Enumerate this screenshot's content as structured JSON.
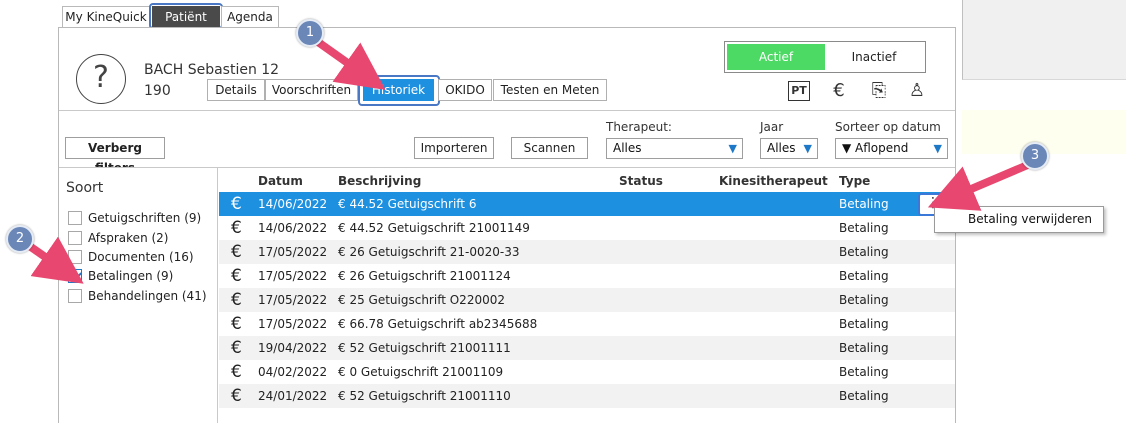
{
  "top_tabs": [
    "My KineQuick",
    "Patiënt",
    "Agenda"
  ],
  "patient": {
    "name": "BACH Sebastien 12",
    "number": "190",
    "avatar_glyph": "?"
  },
  "sub_tabs": [
    "Details",
    "Voorschriften",
    "Historiek",
    "OKIDO",
    "Testen en Meten"
  ],
  "status_toggle": {
    "active": "Actief",
    "inactive": "Inactief"
  },
  "header_icons": {
    "pt": "PT",
    "euro": "€",
    "doc_glyph": "⎘",
    "person_glyph": "♙"
  },
  "toolbar": {
    "hide_filters": "Verberg filters",
    "import": "Importeren",
    "scan": "Scannen",
    "therapist_label": "Therapeut:",
    "therapist_value": "Alles",
    "year_label": "Jaar",
    "year_value": "Alles",
    "sort_label": "Sorteer op datum",
    "sort_value": "▼ Aflopend",
    "dropdown_arrow": "▼"
  },
  "filters": {
    "title": "Soort",
    "items": [
      {
        "label": "Getuigschriften (9)",
        "checked": false
      },
      {
        "label": "Afspraken (2)",
        "checked": false
      },
      {
        "label": "Documenten (16)",
        "checked": false
      },
      {
        "label": "Betalingen (9)",
        "checked": true
      },
      {
        "label": "Behandelingen (41)",
        "checked": false
      }
    ]
  },
  "table": {
    "columns": [
      "Datum",
      "Beschrijving",
      "Status",
      "Kinesitherapeut",
      "Type"
    ],
    "row_icon": "€",
    "rows": [
      {
        "date": "14/06/2022",
        "desc": "€ 44.52 Getuigschrift 6",
        "type": "Betaling",
        "selected": true
      },
      {
        "date": "14/06/2022",
        "desc": "€ 44.52 Getuigschrift 21001149",
        "type": "Betaling"
      },
      {
        "date": "17/05/2022",
        "desc": "€ 26 Getuigschrift 21-0020-33",
        "type": "Betaling"
      },
      {
        "date": "17/05/2022",
        "desc": "€ 26 Getuigschrift 21001124",
        "type": "Betaling"
      },
      {
        "date": "17/05/2022",
        "desc": "€ 25 Getuigschrift O220002",
        "type": "Betaling"
      },
      {
        "date": "17/05/2022",
        "desc": "€ 66.78 Getuigschrift ab2345688",
        "type": "Betaling"
      },
      {
        "date": "19/04/2022",
        "desc": "€ 52 Getuigschrift 21001111",
        "type": "Betaling"
      },
      {
        "date": "04/02/2022",
        "desc": "€ 0 Getuigschrift 21001109",
        "type": "Betaling"
      },
      {
        "date": "24/01/2022",
        "desc": "€ 52 Getuigschrift 21001110",
        "type": "Betaling"
      }
    ]
  },
  "row_menu": {
    "kebab": "⋮",
    "item": "Betaling verwijderen"
  },
  "callouts": [
    "1",
    "2",
    "3"
  ],
  "colors": {
    "accent_blue": "#1e90e0",
    "active_green": "#4cd964",
    "callout_pink": "#e8476f",
    "callout_badge": "#6b87b8"
  }
}
